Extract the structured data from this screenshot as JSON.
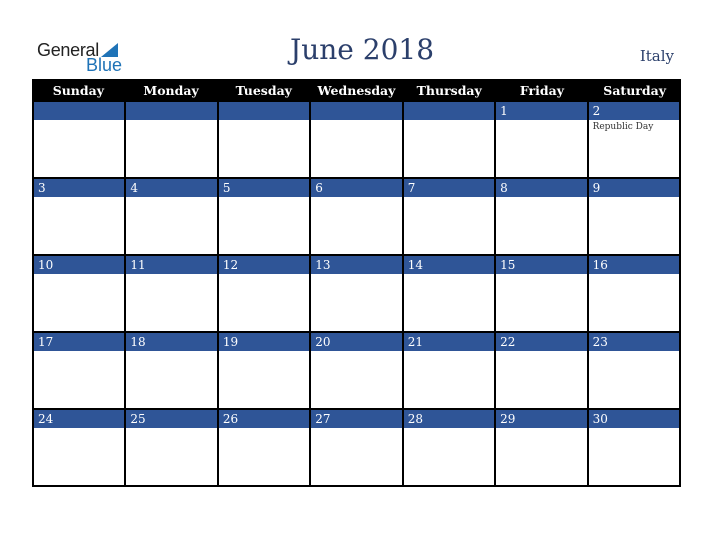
{
  "logo": {
    "line1": "General",
    "line2": "Blue",
    "icon": "triangle-flag-icon"
  },
  "title": "June 2018",
  "country": "Italy",
  "colors": {
    "accent": "#2f5597",
    "header_bg": "#000000",
    "title": "#2b3f6b",
    "logo_blue": "#1f73b7"
  },
  "weekdays": [
    "Sunday",
    "Monday",
    "Tuesday",
    "Wednesday",
    "Thursday",
    "Friday",
    "Saturday"
  ],
  "weeks": [
    [
      {
        "day": ""
      },
      {
        "day": ""
      },
      {
        "day": ""
      },
      {
        "day": ""
      },
      {
        "day": ""
      },
      {
        "day": "1"
      },
      {
        "day": "2",
        "holiday": "Republic Day"
      }
    ],
    [
      {
        "day": "3"
      },
      {
        "day": "4"
      },
      {
        "day": "5"
      },
      {
        "day": "6"
      },
      {
        "day": "7"
      },
      {
        "day": "8"
      },
      {
        "day": "9"
      }
    ],
    [
      {
        "day": "10"
      },
      {
        "day": "11"
      },
      {
        "day": "12"
      },
      {
        "day": "13"
      },
      {
        "day": "14"
      },
      {
        "day": "15"
      },
      {
        "day": "16"
      }
    ],
    [
      {
        "day": "17"
      },
      {
        "day": "18"
      },
      {
        "day": "19"
      },
      {
        "day": "20"
      },
      {
        "day": "21"
      },
      {
        "day": "22"
      },
      {
        "day": "23"
      }
    ],
    [
      {
        "day": "24"
      },
      {
        "day": "25"
      },
      {
        "day": "26"
      },
      {
        "day": "27"
      },
      {
        "day": "28"
      },
      {
        "day": "29"
      },
      {
        "day": "30"
      }
    ]
  ]
}
